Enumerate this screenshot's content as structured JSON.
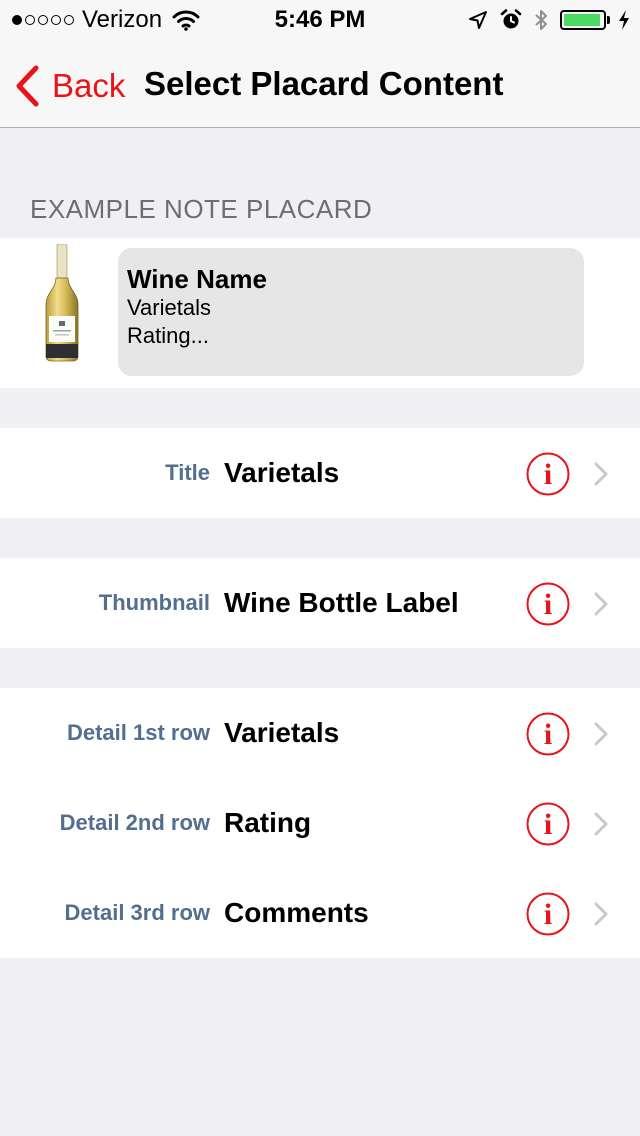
{
  "status_bar": {
    "carrier": "Verizon",
    "time": "5:46 PM",
    "signal_bars_filled": 1,
    "signal_bars_total": 5,
    "battery_level_fraction": 0.95,
    "battery_color": "#4cd964"
  },
  "nav": {
    "back_label": "Back",
    "title": "Select Placard Content",
    "accent_color": "#e8141a"
  },
  "example_section": {
    "header": "EXAMPLE NOTE PLACARD",
    "placard": {
      "title": "Wine Name",
      "line1": "Varietals",
      "line2": "Rating..."
    }
  },
  "rows": {
    "title": {
      "label": "Title",
      "value": "Varietals"
    },
    "thumbnail": {
      "label": "Thumbnail",
      "value": "Wine Bottle Label"
    },
    "detail1": {
      "label": "Detail 1st row",
      "value": "Varietals"
    },
    "detail2": {
      "label": "Detail 2nd row",
      "value": "Rating"
    },
    "detail3": {
      "label": "Detail 3rd row",
      "value": "Comments"
    }
  },
  "icons": {
    "info": "info-icon",
    "chevron": "chevron-right-icon",
    "back": "chevron-left-icon"
  },
  "colors": {
    "label_color": "#536e8e",
    "info_color": "#e8141a",
    "background": "#efeff4"
  }
}
